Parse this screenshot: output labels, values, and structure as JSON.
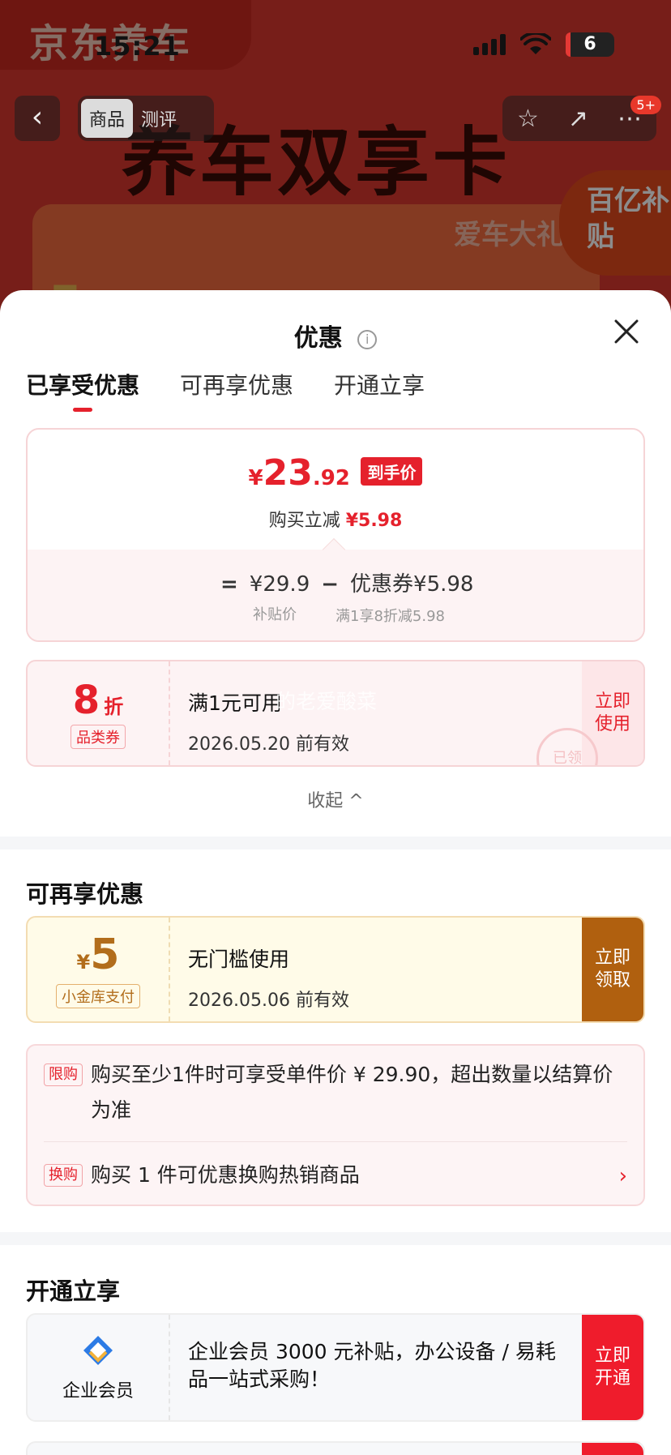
{
  "status": {
    "time": "15:21",
    "battery": "6"
  },
  "background": {
    "brand": "京东养车",
    "hero": "养车双享卡",
    "card_tag": "爱车大礼",
    "subsidy": "百亿补贴",
    "stripe": "5",
    "nav": {
      "back": "‹",
      "tabs": [
        "商品",
        "测评"
      ],
      "badge": "5+"
    }
  },
  "sheet": {
    "title": "优惠",
    "tabs": [
      {
        "label": "已享受优惠",
        "active": true
      },
      {
        "label": "可再享优惠",
        "active": false
      },
      {
        "label": "开通立享",
        "active": false
      }
    ],
    "price": {
      "yen": "¥",
      "integer": "23",
      "decimal": ".92",
      "tag": "到手价",
      "sub_label": "购买立减",
      "sub_value": "¥5.98",
      "eq": "=",
      "base": "¥29.9",
      "minus": "−",
      "coupon_label": "优惠券¥5.98",
      "base_note": "补贴价",
      "coupon_note": "满1享8折减5.98"
    },
    "coupon_applied": {
      "value": "8",
      "unit": "折",
      "label": "品类券",
      "title": "满1元可用",
      "ghost": "的老爱酸菜",
      "expiry": "2026.05.20 前有效",
      "action": "立即使用",
      "stamp": "已领"
    },
    "collapse": "收起 ^",
    "section2_title": "可再享优惠",
    "coupon_more": {
      "yen": "¥",
      "value": "5",
      "label": "小金库支付",
      "title": "无门槛使用",
      "expiry": "2026.05.06 前有效",
      "action": "立即领取"
    },
    "rules": [
      {
        "tag": "限购",
        "text": "购买至少1件时可享受单件价 ¥ 29.90，超出数量以结算价为准"
      },
      {
        "tag": "换购",
        "text": "购买 1 件可优惠换购热销商品"
      }
    ],
    "section3_title": "开通立享",
    "membership": {
      "label": "企业会员",
      "title": "企业会员 3000 元补贴，办公设备 / 易耗品一站式采购！",
      "action": "立即开通"
    }
  },
  "colors": {
    "accent": "#e5212c",
    "gold": "#b0600f"
  }
}
